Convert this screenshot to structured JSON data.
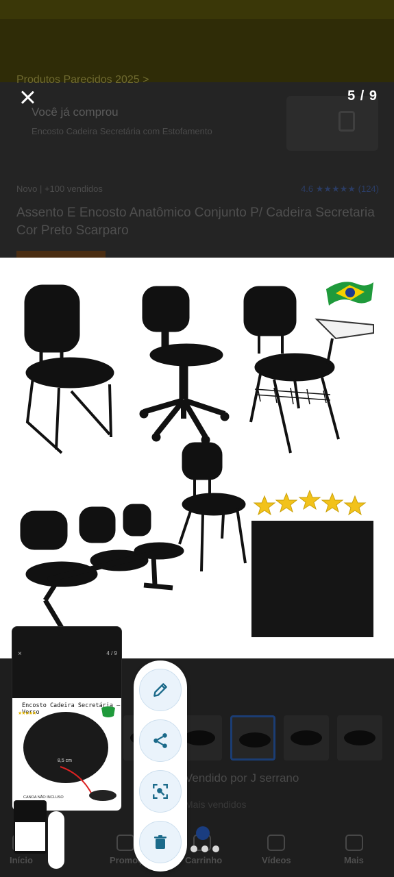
{
  "background": {
    "category": "Produtos Parecidos 2025 >",
    "bought_title": "Você já comprou",
    "bought_sub": "Encosto Cadeira Secretária com Estofamento",
    "meta": "Novo  |  +100 vendidos",
    "rating": "4.6 ★★★★★ (124)",
    "product_title": "Assento E Encosto Anatômico Conjunto P/ Cadeira Secretaria Cor Preto Scarparo",
    "seller": "Vendido por J serrano",
    "seller_sub": "Mais vendidos",
    "tabs": [
      {
        "label": "Início",
        "icon": "home-icon"
      },
      {
        "label": "Promoções",
        "icon": "tag-icon"
      },
      {
        "label": "Carrinho",
        "icon": "cart-icon"
      },
      {
        "label": "Vídeos",
        "icon": "video-icon"
      },
      {
        "label": "Mais",
        "icon": "menu-icon"
      }
    ]
  },
  "viewer": {
    "counter": "5 / 9",
    "close_icon": "close-icon"
  },
  "main_image": {
    "description_icons": [
      "brazil-flag-icon",
      "five-stars-icon"
    ],
    "stars": 5
  },
  "screenshot_preview": {
    "counter": "4 / 9",
    "close": "×",
    "title": "Encosto Cadeira Secretária — Verso",
    "stars": "★★★★★",
    "measure": "8,5 cm",
    "caption": "CANOA NÃO INCLUSO"
  },
  "actions": [
    {
      "name": "edit-button",
      "icon": "pencil-icon"
    },
    {
      "name": "share-button",
      "icon": "share-icon"
    },
    {
      "name": "lens-button",
      "icon": "scan-icon"
    },
    {
      "name": "delete-button",
      "icon": "trash-icon"
    }
  ],
  "colors": {
    "accent": "#1b6a8a",
    "action_bg": "#eaf3fb",
    "overlay": "#242424"
  }
}
